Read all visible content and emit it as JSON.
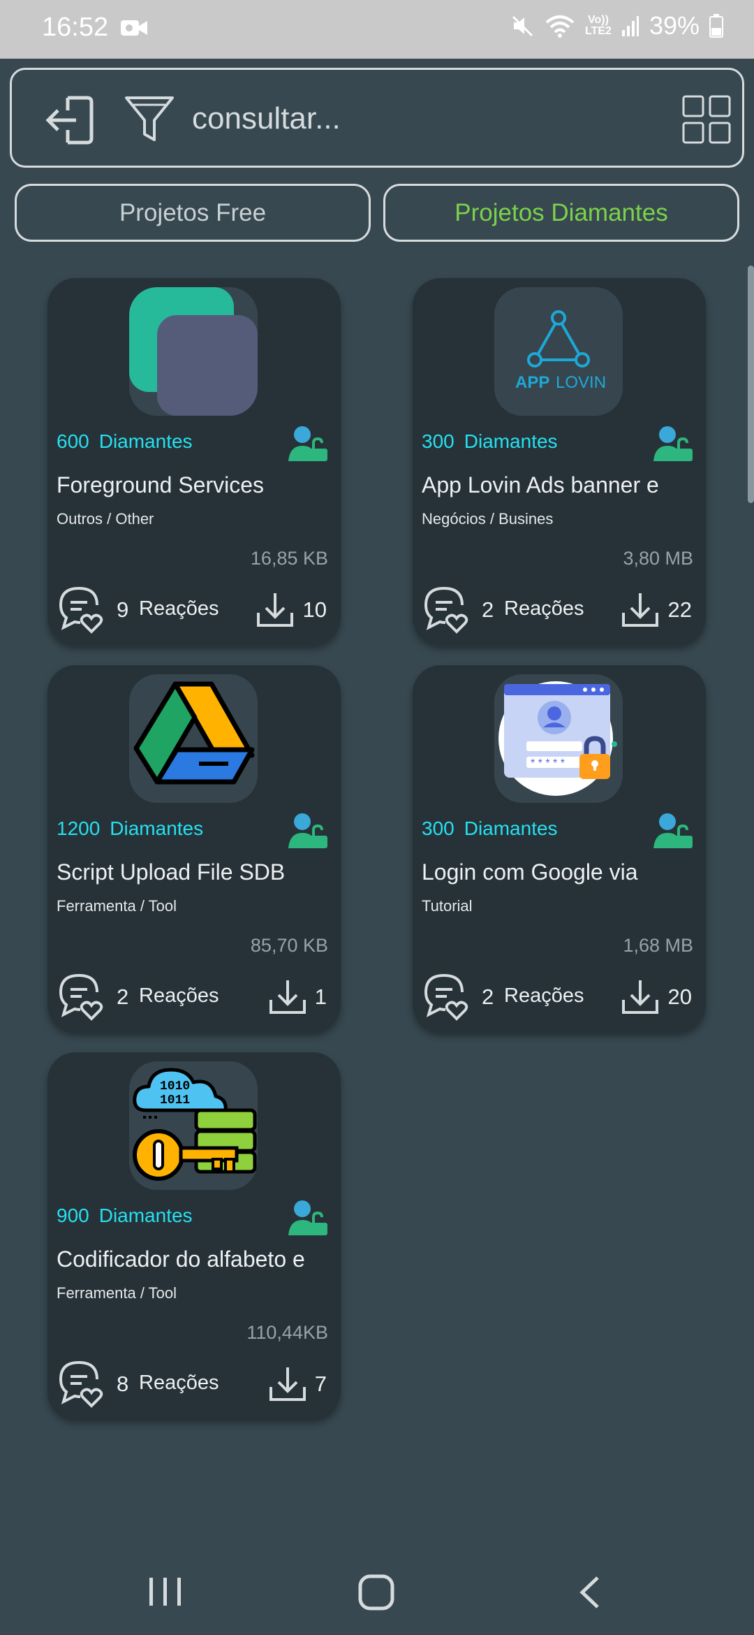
{
  "status_bar": {
    "time": "16:52",
    "volte_top": "Vo))",
    "volte_bottom": "LTE2",
    "battery": "39%"
  },
  "search": {
    "placeholder": "consultar..."
  },
  "tabs": [
    {
      "label": "Projetos Free",
      "active": false
    },
    {
      "label": "Projetos Diamantes",
      "active": true
    }
  ],
  "colors": {
    "background": "#374850",
    "card": "#263238",
    "price": "#26e0f0",
    "active_tab": "#7bd34a"
  },
  "cards": [
    {
      "diamonds": "600",
      "diamonds_label": "Diamantes",
      "title": "Foreground Services",
      "category": "Outros / Other",
      "size": "16,85 KB",
      "reactions": "9",
      "reactions_label": "Reações",
      "downloads": "10",
      "icon": "foreground-services-icon"
    },
    {
      "diamonds": "300",
      "diamonds_label": "Diamantes",
      "title": "App Lovin Ads banner e",
      "category": "Negócios / Busines",
      "size": "3,80 MB",
      "reactions": "2",
      "reactions_label": "Reações",
      "downloads": "22",
      "icon": "applovin-logo",
      "logo_text_1": "APP",
      "logo_text_2": "LOVIN"
    },
    {
      "diamonds": "1200",
      "diamonds_label": "Diamantes",
      "title": "Script Upload File SDB",
      "category": "Ferramenta / Tool",
      "size": "85,70 KB",
      "reactions": "2",
      "reactions_label": "Reações",
      "downloads": "1",
      "icon": "google-drive-icon"
    },
    {
      "diamonds": "300",
      "diamonds_label": "Diamantes",
      "title": "Login com Google via",
      "category": "Tutorial",
      "size": "1,68 MB",
      "reactions": "2",
      "reactions_label": "Reações",
      "downloads": "20",
      "icon": "login-lock-icon"
    },
    {
      "diamonds": "900",
      "diamonds_label": "Diamantes",
      "title": "Codificador do alfabeto e",
      "category": "Ferramenta / Tool",
      "size": "110,44KB",
      "reactions": "8",
      "reactions_label": "Reações",
      "downloads": "7",
      "icon": "encoder-key-icon",
      "logo_text_1": "1010",
      "logo_text_2": "1011"
    }
  ]
}
